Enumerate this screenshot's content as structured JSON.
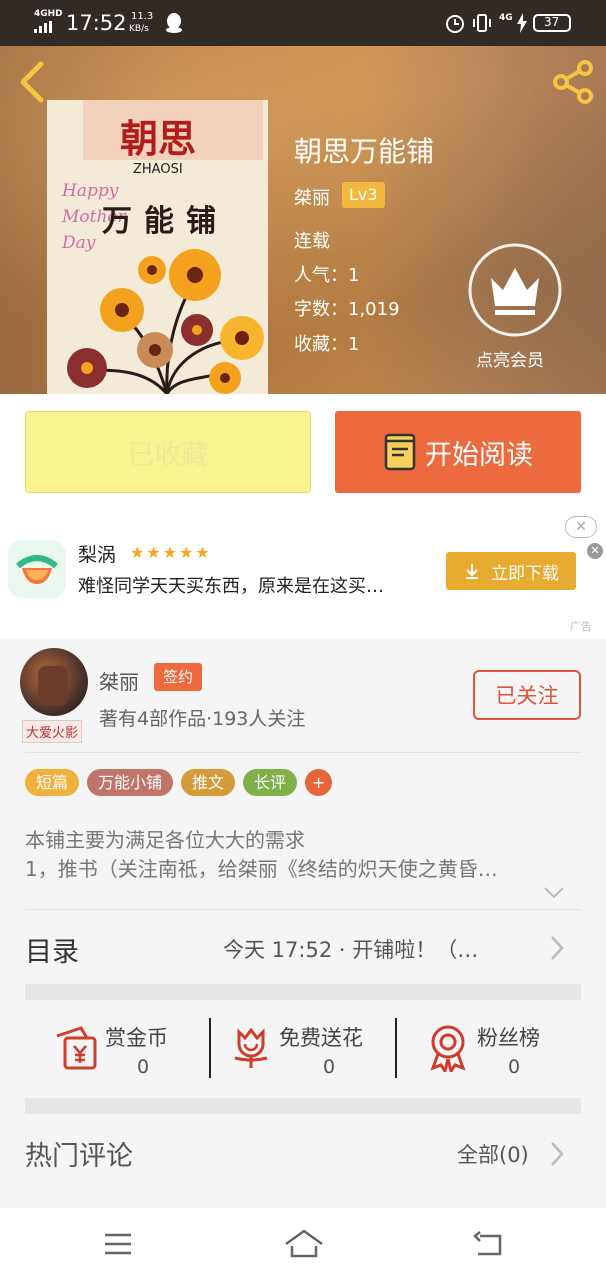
{
  "status": {
    "network": "4GHD",
    "time": "17:52",
    "speed_value": "11.3",
    "speed_unit": "KB/s",
    "signal2": "4G",
    "battery": "37"
  },
  "book": {
    "title": "朝思万能铺",
    "author": "桀丽",
    "level": "Lv3",
    "status": "连载",
    "popularity": "人气：1",
    "word_count": "字数：1,019",
    "favorites": "收藏：1",
    "vip_label": "点亮会员"
  },
  "cover": {
    "title_top": "朝思",
    "pinyin": "ZHAOSI",
    "title_bottom": "万能铺",
    "script_text": "Happy Mother Day"
  },
  "actions": {
    "favorited": "已收藏",
    "start_reading": "开始阅读"
  },
  "ad": {
    "app_name": "梨涡",
    "stars": "★★★★★",
    "rating": 5,
    "description": "难怪同学天天买东西，原来是在这买…",
    "download": "立即下载",
    "ad_label": "广告"
  },
  "authorcard": {
    "name": "桀丽",
    "badge": "签约",
    "stats": "著有4部作品·193人关注",
    "follow": "已关注",
    "avatar_caption": "大爱火影"
  },
  "tags": [
    {
      "label": "短篇",
      "color": "#f0b03c"
    },
    {
      "label": "万能小铺",
      "color": "#c0756a"
    },
    {
      "label": "推文",
      "color": "#d39b3a"
    },
    {
      "label": "长评",
      "color": "#7fb04a"
    },
    {
      "label": "+",
      "color": "#e8643a"
    }
  ],
  "intro": {
    "line1": "本铺主要为满足各位大大的需求",
    "line2": "1，推书（关注南祗，给桀丽《终结的炽天使之黄昏…"
  },
  "toc": {
    "label": "目录",
    "latest": "今天 17:52 · 开铺啦！（…"
  },
  "support": [
    {
      "label": "赏金币",
      "value": "0"
    },
    {
      "label": "免费送花",
      "value": "0"
    },
    {
      "label": "粉丝榜",
      "value": "0"
    }
  ],
  "comments": {
    "label": "热门评论",
    "all": "全部(0)"
  }
}
